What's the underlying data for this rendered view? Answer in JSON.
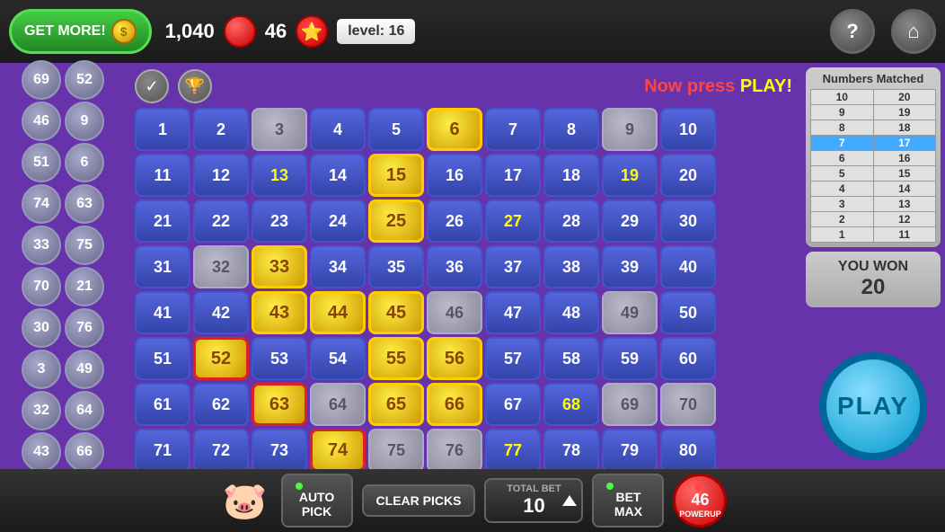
{
  "topBar": {
    "getMoreLabel": "GET MORE!",
    "coins": "1,040",
    "ballCount": "46",
    "levelLabel": "level: 16",
    "helpIcon": "?",
    "homeIcon": "⌂"
  },
  "pressPlay": {
    "nowPress": "Now press ",
    "play": "PLAY!"
  },
  "leftNumbers": [
    [
      69,
      52
    ],
    [
      46,
      9
    ],
    [
      51,
      6
    ],
    [
      74,
      63
    ],
    [
      33,
      75
    ],
    [
      70,
      21
    ],
    [
      30,
      76
    ],
    [
      3,
      49
    ],
    [
      32,
      64
    ],
    [
      43,
      66
    ]
  ],
  "grid": {
    "rows": [
      [
        {
          "n": 1,
          "style": "normal"
        },
        {
          "n": 2,
          "style": "normal"
        },
        {
          "n": 3,
          "style": "selected-gray"
        },
        {
          "n": 4,
          "style": "normal"
        },
        {
          "n": 5,
          "style": "normal"
        },
        {
          "n": 6,
          "style": "picked-yellow"
        },
        {
          "n": 7,
          "style": "normal"
        },
        {
          "n": 8,
          "style": "normal"
        },
        {
          "n": 9,
          "style": "selected-gray"
        },
        {
          "n": 10,
          "style": "normal"
        }
      ],
      [
        {
          "n": 11,
          "style": "normal"
        },
        {
          "n": 12,
          "style": "normal"
        },
        {
          "n": 13,
          "style": "yellow-text"
        },
        {
          "n": 14,
          "style": "normal"
        },
        {
          "n": 15,
          "style": "picked-yellow"
        },
        {
          "n": 16,
          "style": "normal"
        },
        {
          "n": 17,
          "style": "normal"
        },
        {
          "n": 18,
          "style": "normal"
        },
        {
          "n": 19,
          "style": "yellow-text"
        },
        {
          "n": 20,
          "style": "normal"
        }
      ],
      [
        {
          "n": 21,
          "style": "normal"
        },
        {
          "n": 22,
          "style": "normal"
        },
        {
          "n": 23,
          "style": "normal"
        },
        {
          "n": 24,
          "style": "normal"
        },
        {
          "n": 25,
          "style": "picked-yellow"
        },
        {
          "n": 26,
          "style": "normal"
        },
        {
          "n": 27,
          "style": "yellow-text"
        },
        {
          "n": 28,
          "style": "normal"
        },
        {
          "n": 29,
          "style": "normal"
        },
        {
          "n": 30,
          "style": "normal"
        }
      ],
      [
        {
          "n": 31,
          "style": "normal"
        },
        {
          "n": 32,
          "style": "selected-gray"
        },
        {
          "n": 33,
          "style": "picked-yellow"
        },
        {
          "n": 34,
          "style": "normal"
        },
        {
          "n": 35,
          "style": "normal"
        },
        {
          "n": 36,
          "style": "normal"
        },
        {
          "n": 37,
          "style": "normal"
        },
        {
          "n": 38,
          "style": "normal"
        },
        {
          "n": 39,
          "style": "normal"
        },
        {
          "n": 40,
          "style": "normal"
        }
      ],
      [
        {
          "n": 41,
          "style": "normal"
        },
        {
          "n": 42,
          "style": "normal"
        },
        {
          "n": 43,
          "style": "picked-yellow"
        },
        {
          "n": 44,
          "style": "picked-yellow"
        },
        {
          "n": 45,
          "style": "picked-yellow"
        },
        {
          "n": 46,
          "style": "selected-gray"
        },
        {
          "n": 47,
          "style": "normal"
        },
        {
          "n": 48,
          "style": "normal"
        },
        {
          "n": 49,
          "style": "selected-gray"
        },
        {
          "n": 50,
          "style": "normal"
        }
      ],
      [
        {
          "n": 51,
          "style": "normal"
        },
        {
          "n": 52,
          "style": "picked-red-border"
        },
        {
          "n": 53,
          "style": "normal"
        },
        {
          "n": 54,
          "style": "normal"
        },
        {
          "n": 55,
          "style": "picked-yellow"
        },
        {
          "n": 56,
          "style": "picked-yellow"
        },
        {
          "n": 57,
          "style": "normal"
        },
        {
          "n": 58,
          "style": "normal"
        },
        {
          "n": 59,
          "style": "normal"
        },
        {
          "n": 60,
          "style": "normal"
        }
      ],
      [
        {
          "n": 61,
          "style": "normal"
        },
        {
          "n": 62,
          "style": "normal"
        },
        {
          "n": 63,
          "style": "picked-red-border"
        },
        {
          "n": 64,
          "style": "selected-gray"
        },
        {
          "n": 65,
          "style": "picked-yellow"
        },
        {
          "n": 66,
          "style": "picked-yellow"
        },
        {
          "n": 67,
          "style": "normal"
        },
        {
          "n": 68,
          "style": "yellow-text"
        },
        {
          "n": 69,
          "style": "selected-gray"
        },
        {
          "n": 70,
          "style": "selected-gray"
        }
      ],
      [
        {
          "n": 71,
          "style": "normal"
        },
        {
          "n": 72,
          "style": "normal"
        },
        {
          "n": 73,
          "style": "normal"
        },
        {
          "n": 74,
          "style": "picked-red-border"
        },
        {
          "n": 75,
          "style": "selected-gray"
        },
        {
          "n": 76,
          "style": "selected-gray"
        },
        {
          "n": 77,
          "style": "yellow-text"
        },
        {
          "n": 78,
          "style": "normal"
        },
        {
          "n": 79,
          "style": "normal"
        },
        {
          "n": 80,
          "style": "normal"
        }
      ]
    ]
  },
  "numbersMatched": {
    "title": "Numbers Matched",
    "columns": [
      "",
      ""
    ],
    "rows": [
      {
        "left": "10",
        "right": "20",
        "leftHL": false,
        "rightHL": false
      },
      {
        "left": "9",
        "right": "19",
        "leftHL": false,
        "rightHL": false
      },
      {
        "left": "8",
        "right": "18",
        "leftHL": false,
        "rightHL": false
      },
      {
        "left": "7",
        "right": "17",
        "leftHL": true,
        "rightHL": true
      },
      {
        "left": "6",
        "right": "16",
        "leftHL": false,
        "rightHL": false
      },
      {
        "left": "5",
        "right": "15",
        "leftHL": false,
        "rightHL": false
      },
      {
        "left": "4",
        "right": "14",
        "leftHL": false,
        "rightHL": false
      },
      {
        "left": "3",
        "right": "13",
        "leftHL": false,
        "rightHL": false
      },
      {
        "left": "2",
        "right": "12",
        "leftHL": false,
        "rightHL": false
      },
      {
        "left": "1",
        "right": "11",
        "leftHL": false,
        "rightHL": false
      }
    ]
  },
  "youWon": {
    "label": "YOU WON",
    "amount": "20"
  },
  "playBtn": "PLAY",
  "bottomBar": {
    "autoPickLabel": "AUTO\nPICK",
    "clearPicksLabel": "CLEAR\nPICKS",
    "totalBetLabel": "TOTAL BET",
    "totalBetValue": "10",
    "betMaxLabel": "BET\nMAX",
    "powerupValue": "46",
    "powerupLabel": "POWERUP"
  }
}
